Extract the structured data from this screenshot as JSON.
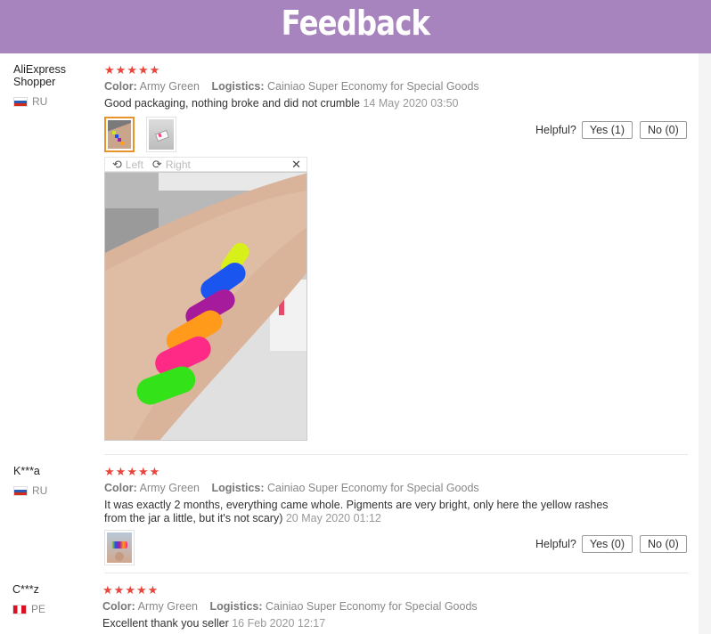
{
  "banner": {
    "title": "Feedback"
  },
  "colors": {
    "banner": "#a784bd",
    "stars": "#e8453c",
    "active_thumb": "#e8942a"
  },
  "reviews": [
    {
      "user": "AliExpress Shopper",
      "country": "RU",
      "flag": "russia-flag",
      "rating": 5,
      "color_label": "Color:",
      "color_value": "Army Green",
      "logistics_label": "Logistics:",
      "logistics_value": "Cainiao Super Economy for Special Goods",
      "text": "Good packaging, nothing broke and did not crumble",
      "date": "14 May 2020 03:50",
      "helpful_label": "Helpful?",
      "yes_label": "Yes (1)",
      "no_label": "No (0)",
      "viewer": {
        "left_label": "Left",
        "right_label": "Right",
        "close_icon": "close-icon"
      }
    },
    {
      "user": "K***a",
      "country": "RU",
      "flag": "russia-flag",
      "rating": 5,
      "color_label": "Color:",
      "color_value": "Army Green",
      "logistics_label": "Logistics:",
      "logistics_value": "Cainiao Super Economy for Special Goods",
      "text_line1": "It was exactly 2 months, everything came whole. Pigments are very bright, only here the yellow rashes",
      "text_line2": "from the jar a little, but it's not scary)",
      "date": "20 May 2020 01:12",
      "helpful_label": "Helpful?",
      "yes_label": "Yes (0)",
      "no_label": "No (0)"
    },
    {
      "user": "C***z",
      "country": "PE",
      "flag": "peru-flag",
      "rating": 5,
      "color_label": "Color:",
      "color_value": "Army Green",
      "logistics_label": "Logistics:",
      "logistics_value": "Cainiao Super Economy for Special Goods",
      "text": "Excellent thank you seller",
      "date": "16 Feb 2020 12:17"
    }
  ]
}
